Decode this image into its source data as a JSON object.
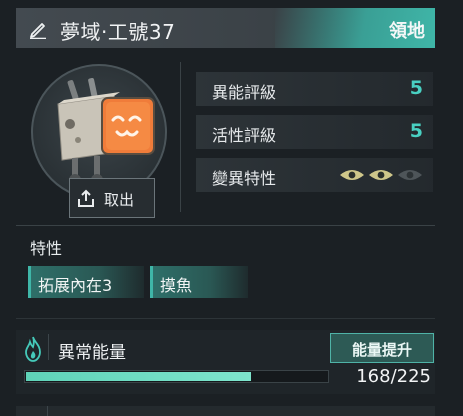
{
  "header": {
    "title": "夢域·工號37",
    "territory_label": "領地"
  },
  "avatar": {
    "withdraw_label": "取出"
  },
  "stats": [
    {
      "label": "異能評級",
      "value": "5"
    },
    {
      "label": "活性評級",
      "value": "5"
    },
    {
      "label": "變異特性",
      "eyes_active": 2,
      "eyes_total": 3
    }
  ],
  "traits": {
    "title": "特性",
    "tags": [
      "拓展內在3",
      "摸魚"
    ]
  },
  "energy": {
    "label": "異常能量",
    "boost_label": "能量提升",
    "current": 168,
    "max": 225,
    "count_text": "168/225"
  },
  "colors": {
    "accent": "#3fb6a8",
    "value": "#49d0c2",
    "bar": "#6fdcc2",
    "eye_active": "#cfc78a",
    "eye_inactive": "#4e5559"
  }
}
